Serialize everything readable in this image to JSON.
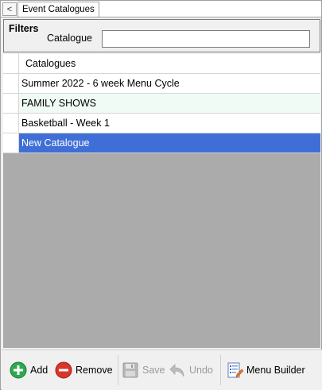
{
  "tab": {
    "back_glyph": "<",
    "title": "Event Catalogues"
  },
  "filters": {
    "title": "Filters",
    "catalogue_label": "Catalogue",
    "catalogue_value": ""
  },
  "grid": {
    "header": "Catalogues",
    "rows": [
      "Summer 2022 - 6 week Menu Cycle",
      "FAMILY SHOWS",
      "Basketball - Week 1",
      "New Catalogue"
    ],
    "selected_index": 3
  },
  "toolbar": {
    "add_label": "Add",
    "remove_label": "Remove",
    "save_label": "Save",
    "undo_label": "Undo",
    "menu_builder_label": "Menu Builder"
  },
  "icons": {
    "add": "plus-circle-icon",
    "remove": "minus-circle-icon",
    "save": "floppy-disk-icon",
    "undo": "undo-arrow-icon",
    "menu_builder": "document-edit-icon"
  },
  "colors": {
    "selection": "#3f6fd6",
    "alt_row": "#f0fbf5",
    "grid_empty": "#ababab",
    "add_green": "#2fa84f",
    "remove_red": "#d9362b"
  }
}
